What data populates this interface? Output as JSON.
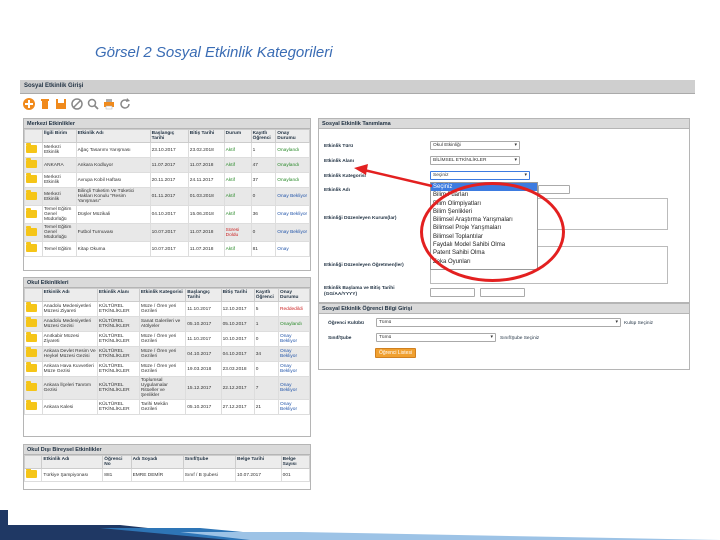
{
  "slide_title": "Görsel 2 Sosyal Etkinlik Kategorileri",
  "app": {
    "title": "Sosyal Etkinlik Girişi"
  },
  "toolbar": {
    "icons": [
      "add-icon",
      "delete-icon",
      "save-icon",
      "cancel-icon",
      "search-icon",
      "print-icon",
      "refresh-icon"
    ]
  },
  "merkezi": {
    "title": "Merkezi Etkinlikler",
    "headers": [
      "",
      "İlgili Birim",
      "Etkinlik Adı",
      "Başlangıç Tarihi",
      "Bitiş Tarihi",
      "Durum",
      "Kayıtlı Öğrenci",
      "Onay Durumu"
    ],
    "rows": [
      [
        "",
        "Merkezi Etkinlik",
        "Ağaç Tasarımı Yarışması",
        "23.10.2017",
        "23.02.2018",
        "Aktif",
        "1",
        "Onaylandı"
      ],
      [
        "",
        "ANKARA",
        "Ankara Kodluyor",
        "11.07.2017",
        "11.07.2018",
        "Aktif",
        "47",
        "Onaylandı"
      ],
      [
        "",
        "Merkezi Etkinlik",
        "Avrupa Kobil Haftası",
        "20.11.2017",
        "24.11.2017",
        "Aktif",
        "37",
        "Onaylandı"
      ],
      [
        "",
        "Merkezi Etkinlik",
        "Bilinçli Tüketim Ve Tüketici Hakları Konulu \"Resim Yarışması\"",
        "01.11.2017",
        "01.03.2018",
        "Aktif",
        "0",
        "Onay Bekliyor"
      ],
      [
        "",
        "Temel Eğitim Genel Müdürlüğü",
        "Düşler Müzikali",
        "04.10.2017",
        "15.06.2018",
        "Aktif",
        "36",
        "Onay Bekliyor"
      ],
      [
        "",
        "Temel Eğitim Genel Müdürlüğü",
        "Futbol Turnuvası",
        "10.07.2017",
        "11.07.2018",
        "Süresi Doldu",
        "0",
        "Onay Bekliyor"
      ],
      [
        "",
        "Temel Eğitim",
        "Kitap Okuma",
        "10.07.2017",
        "11.07.2018",
        "Aktif",
        "81",
        "Onay"
      ]
    ]
  },
  "okul": {
    "title": "Okul Etkinlikleri",
    "headers": [
      "",
      "Etkinlik Adı",
      "Etkinlik Alanı",
      "Etkinlik Kategorisi",
      "Başlangıç Tarihi",
      "Bitiş Tarihi",
      "Kayıtlı Öğrenci",
      "Onay Durumu"
    ],
    "rows": [
      [
        "",
        "Anadolu Medeniyetleri Müzesi Ziyareti",
        "KÜLTÜREL ETKİNLİKLER",
        "Müze / Ören yeri Gezileri",
        "11.10.2017",
        "12.10.2017",
        "5",
        "Reddedildi"
      ],
      [
        "",
        "Anadolu Medeniyetleri Müzesi Gezisi",
        "KÜLTÜREL ETKİNLİKLER",
        "Sanat Galerileri ve Atölyeler",
        "05.10.2017",
        "05.10.2017",
        "1",
        "Onaylandı"
      ],
      [
        "",
        "Anıtkabir Müzesi Ziyareti",
        "KÜLTÜREL ETKİNLİKLER",
        "Müze / Ören yeri Gezileri",
        "11.10.2017",
        "10.10.2017",
        "0",
        "Onay Bekliyor"
      ],
      [
        "",
        "Ankara Devlet Resim Ve Heykel Müzesi Gezisi",
        "KÜLTÜREL ETKİNLİKLER",
        "Müze / Ören yeri Gezileri",
        "04.10.2017",
        "04.10.2017",
        "34",
        "Onay Bekliyor"
      ],
      [
        "",
        "Ankara Hava Kuvvetleri Müze Gezisi",
        "KÜLTÜREL ETKİNLİKLER",
        "Müze / Ören yeri Gezileri",
        "19.03.2018",
        "23.03.2018",
        "0",
        "Onay Bekliyor"
      ],
      [
        "",
        "Ankara İlçeleri Tanıtım Gezisi",
        "KÜLTÜREL ETKİNLİKLER",
        "Toplumsal Uygulamalar Ritüeller ve Şenlikler",
        "15.12.2017",
        "22.12.2017",
        "7",
        "Onay Bekliyor"
      ],
      [
        "",
        "Ankara Kalesi",
        "KÜLTÜREL ETKİNLİKLER",
        "Tarihi Mekân Gezileri",
        "05.10.2017",
        "27.12.2017",
        "21",
        "Onay Bekliyor"
      ]
    ]
  },
  "disi": {
    "title": "Okul Dışı Bireysel Etkinlikler",
    "headers": [
      "",
      "Etkinlik Adı",
      "Öğrenci No",
      "Adı Soyadı",
      "Sınıf/Şube",
      "Belge Tarihi",
      "Belge Sayısı"
    ],
    "rows": [
      [
        "",
        "Türkiye Şampiyonası",
        "881",
        "EMRE DEMİR",
        "Sınıf / B Şubesi",
        "10.07.2017",
        "001"
      ]
    ]
  },
  "tanimlama": {
    "title": "Sosyal Etkinlik Tanımlama",
    "labels": {
      "tur": "Etkinlik Türü",
      "alan": "Etkinlik Alanı",
      "kategori": "Etkinlik Kategorisi",
      "ad": "Etkinlik Adı",
      "kurum": "Etkinliği Düzenleyen Kurum(lar)",
      "ogretmen": "Etkinliği Düzenleyen Öğretmen(ler)",
      "tarih": "Etkinlik Başlama ve Bitiş Tarihi (GG/AA/YYYY)"
    },
    "tur_value": "Okul Etkinliği",
    "alan_value": "BİLİMSEL ETKİNLİKLER",
    "kategori_value": "Seçiniz"
  },
  "dropdown": {
    "options": [
      "Seçiniz",
      "Bilim Fuarları",
      "Bilim Olimpiyatları",
      "Bilim Şenlikleri",
      "Bilimsel Araştırma Yarışmaları",
      "Bilimsel Proje Yarışmaları",
      "Bilimsel Toplantılar",
      "Faydalı Model Sahibi Olma",
      "Patent Sahibi Olma",
      "Zeka Oyunları"
    ],
    "selected_index": 0
  },
  "ogrenci": {
    "title": "Sosyal Etkinlik Öğrenci Bilgi Girişi",
    "kulup_label": "Öğrenci Kulübü",
    "kulup_value": "Tümü",
    "kulup_hint": "Kulüp Seçiniz",
    "sinif_label": "Sınıf/Şube",
    "sinif_value": "Tümü",
    "sinif_hint": "Sınıf/Şube Seçiniz",
    "button": "Öğrenci Listesi"
  },
  "colors": {
    "annotation": "#e32020",
    "title": "#3a6cb4",
    "approved": "#2a8a2a",
    "pending": "#2255aa",
    "rejected": "#cc2222",
    "button": "#f0a030"
  }
}
